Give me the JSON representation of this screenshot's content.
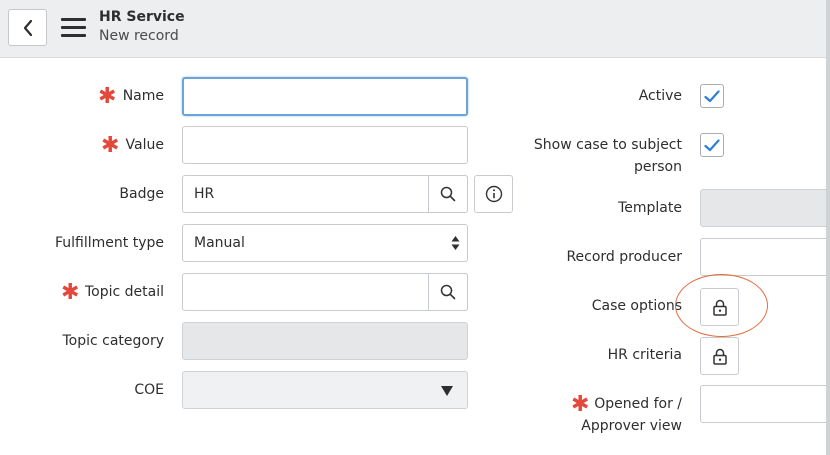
{
  "header": {
    "title": "HR Service",
    "subtitle": "New record"
  },
  "left_fields": {
    "name": {
      "label": "Name",
      "required": true,
      "value": ""
    },
    "value": {
      "label": "Value",
      "required": true,
      "value": ""
    },
    "badge": {
      "label": "Badge",
      "value": "HR"
    },
    "fulfillment_type": {
      "label": "Fulfillment type",
      "selected": "Manual"
    },
    "topic_detail": {
      "label": "Topic detail",
      "required": true,
      "value": ""
    },
    "topic_category": {
      "label": "Topic category",
      "value": ""
    },
    "coe": {
      "label": "COE",
      "selected": ""
    }
  },
  "right_fields": {
    "active": {
      "label": "Active",
      "checked": true
    },
    "show_case": {
      "label_line1": "Show case to subject",
      "label_line2": "person",
      "checked": true
    },
    "template": {
      "label": "Template",
      "value": ""
    },
    "record_producer": {
      "label": "Record producer",
      "value": ""
    },
    "case_options": {
      "label": "Case options"
    },
    "hr_criteria": {
      "label": "HR criteria"
    },
    "opened_for": {
      "label_line1": "Opened for /",
      "label_line2": "Approver view",
      "required": true,
      "value": ""
    }
  },
  "required_marker": "✱",
  "colors": {
    "required": "#e4473c",
    "check": "#2d7fd3",
    "focus_border": "#6aa4d8",
    "highlight": "#e46a3e",
    "header_bg": "#eceef0"
  },
  "icons": [
    "chevron-left-icon",
    "hamburger-menu-icon",
    "search-icon",
    "info-icon",
    "lock-icon",
    "checkmark-icon",
    "select-arrows-icon",
    "dropdown-triangle-icon"
  ]
}
